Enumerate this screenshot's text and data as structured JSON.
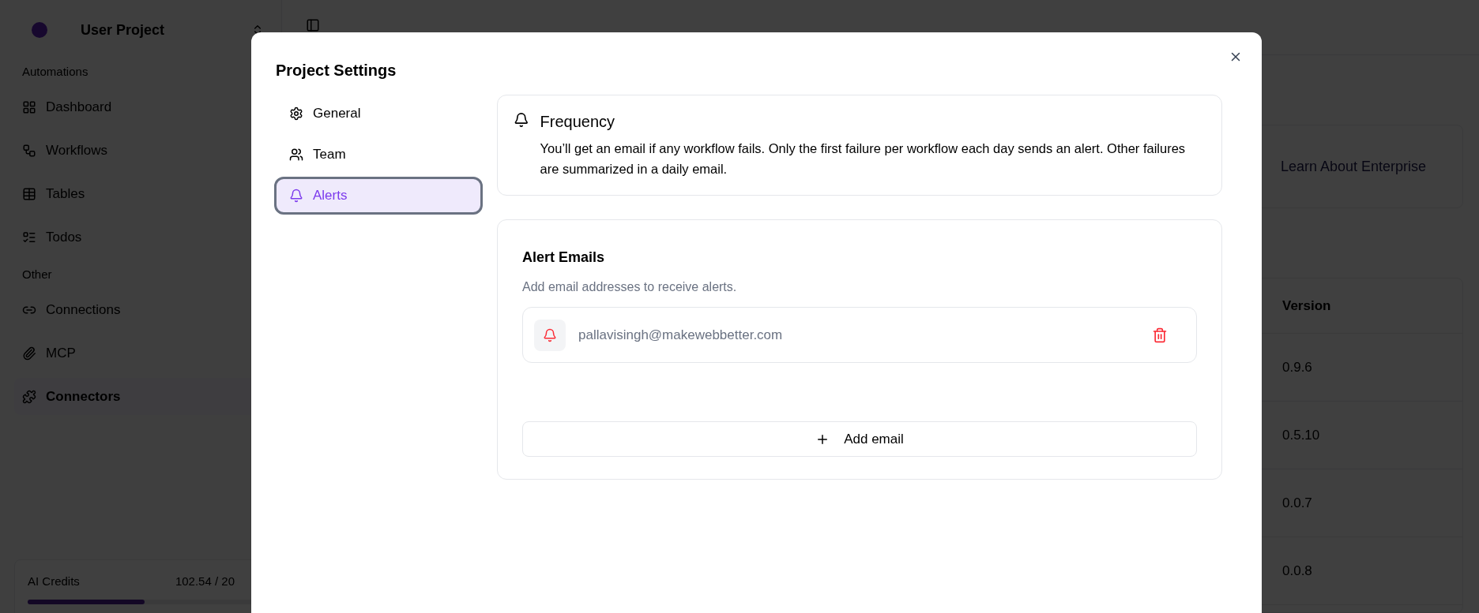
{
  "sidebar": {
    "project": "User Project",
    "sections": [
      {
        "title": "Automations",
        "items": [
          {
            "label": "Dashboard",
            "selected": false
          },
          {
            "label": "Workflows",
            "selected": false
          },
          {
            "label": "Tables",
            "selected": false
          },
          {
            "label": "Todos",
            "selected": false
          }
        ]
      },
      {
        "title": "Other",
        "items": [
          {
            "label": "Connections",
            "selected": false
          },
          {
            "label": "MCP",
            "selected": false
          },
          {
            "label": "Connectors",
            "selected": true
          }
        ]
      }
    ],
    "credits": {
      "label": "AI Credits",
      "value": "102.54 / 20",
      "level": 0.51
    }
  },
  "page": {
    "enterprise_link": "Learn About Enterprise",
    "table": {
      "columns": [
        "Version"
      ],
      "rows": [
        "0.9.6",
        "0.5.10",
        "0.0.7",
        "0.0.8"
      ]
    }
  },
  "modal": {
    "title": "Project Settings",
    "nav": [
      {
        "label": "General",
        "selected": false
      },
      {
        "label": "Team",
        "selected": false
      },
      {
        "label": "Alerts",
        "selected": true
      }
    ],
    "frequency": {
      "title": "Frequency",
      "text": "You’ll get an email if any workflow fails. Only the first failure per workflow each day sends an alert. Other failures are summarized in a daily email."
    },
    "alert_emails": {
      "title": "Alert Emails",
      "description": "Add email addresses to receive alerts.",
      "emails": [
        "pallavisingh@makewebbetter.com"
      ],
      "add_button": "Add email"
    }
  }
}
